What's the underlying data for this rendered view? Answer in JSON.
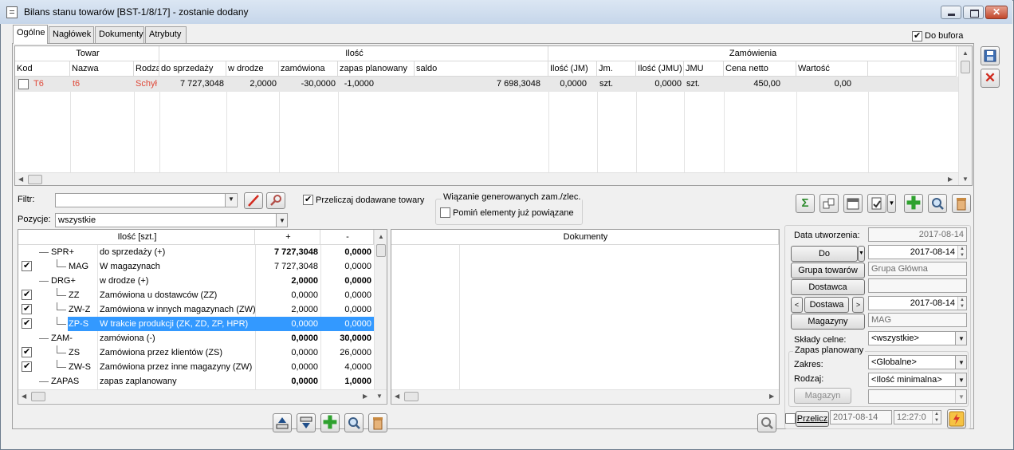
{
  "window": {
    "title": "Bilans stanu towarów [BST-1/8/17] - zostanie dodany"
  },
  "tabs": [
    "Ogólne",
    "Nagłówek",
    "Dokumenty",
    "Atrybuty"
  ],
  "do_bufora": {
    "label": "Do bufora",
    "checked": true
  },
  "top_grid": {
    "groups": {
      "towar": "Towar",
      "ilosc": "Ilość",
      "zamowienia": "Zamówienia"
    },
    "columns": [
      "Kod",
      "Nazwa",
      "Rodza",
      "do sprzedaży",
      "w drodze",
      "zamówiona",
      "zapas planowany",
      "saldo",
      "Ilość (JM)",
      "Jm.",
      "Ilość (JMU)",
      "JMU",
      "Cena netto",
      "Wartość"
    ],
    "row": {
      "kod": "T6",
      "nazwa": "t6",
      "rodzaj": "Schył",
      "do_sprzedazy": "7 727,3048",
      "w_drodze": "2,0000",
      "zamowiona": "-30,0000",
      "zapas": "-1,0000",
      "saldo": "7 698,3048",
      "ilosc_jm": "0,0000",
      "jm": "szt.",
      "ilosc_jmu": "0,0000",
      "jmu": "szt.",
      "cena": "450,00",
      "wartosc": "0,00"
    }
  },
  "filter": {
    "label": "Filtr:",
    "value": ""
  },
  "pozycje": {
    "label": "Pozycje:",
    "value": "wszystkie"
  },
  "przeliczaj": {
    "label": "Przeliczaj dodawane towary",
    "checked": true
  },
  "wiazanie": {
    "title": "Wiązanie generowanych zam./zlec.",
    "pomin_label": "Pomiń elementy już powiązane",
    "checked": false
  },
  "tree": {
    "headers": {
      "ilosc": "Ilość [szt.]",
      "plus": "+",
      "minus": "-"
    },
    "rows": [
      {
        "checked": null,
        "code": "SPR+",
        "name": "do sprzedaży (+)",
        "plus": "7 727,3048",
        "minus": "0,0000",
        "bold": true,
        "indent": 0
      },
      {
        "checked": true,
        "code": "MAG",
        "name": "W magazynach",
        "plus": "7 727,3048",
        "minus": "0,0000",
        "bold": false,
        "indent": 1
      },
      {
        "checked": null,
        "code": "DRG+",
        "name": "w drodze (+)",
        "plus": "2,0000",
        "minus": "0,0000",
        "bold": true,
        "indent": 0
      },
      {
        "checked": true,
        "code": "ZZ",
        "name": "Zamówiona u dostawców (ZZ)",
        "plus": "0,0000",
        "minus": "0,0000",
        "bold": false,
        "indent": 1
      },
      {
        "checked": true,
        "code": "ZW-Z",
        "name": "Zamówiona w innych magazynach (ZW)",
        "plus": "2,0000",
        "minus": "0,0000",
        "bold": false,
        "indent": 1
      },
      {
        "checked": true,
        "code": "ZP-S",
        "name": "W trakcie produkcji (ZK, ZD, ZP, HPR)",
        "plus": "0,0000",
        "minus": "0,0000",
        "bold": false,
        "indent": 1,
        "selected": true
      },
      {
        "checked": null,
        "code": "ZAM-",
        "name": "zamówiona (-)",
        "plus": "0,0000",
        "minus": "30,0000",
        "bold": true,
        "indent": 0
      },
      {
        "checked": true,
        "code": "ZS",
        "name": "Zamówiona przez klientów (ZS)",
        "plus": "0,0000",
        "minus": "26,0000",
        "bold": false,
        "indent": 1
      },
      {
        "checked": true,
        "code": "ZW-S",
        "name": "Zamówiona przez inne magazyny (ZW)",
        "plus": "0,0000",
        "minus": "4,0000",
        "bold": false,
        "indent": 1
      },
      {
        "checked": null,
        "code": "ZAPAS",
        "name": "zapas zaplanowany",
        "plus": "0,0000",
        "minus": "1,0000",
        "bold": true,
        "indent": 0
      }
    ]
  },
  "documents": {
    "header": "Dokumenty"
  },
  "right_panel": {
    "data_utworzenia_label": "Data utworzenia:",
    "data_utworzenia": "2017-08-14",
    "do_label": "Do",
    "do_date": "2017-08-14",
    "grupa_label": "Grupa towarów",
    "grupa_value": "Grupa Główna",
    "dostawca_label": "Dostawca",
    "dostawca_value": "",
    "dostawa_label": "Dostawa",
    "dostawa_date": "2017-08-14",
    "magazyny_label": "Magazyny",
    "magazyny_value": "MAG",
    "sklady_label": "Składy celne:",
    "sklady_value": "<wszystkie>",
    "zapas_title": "Zapas planowany",
    "zakres_label": "Zakres:",
    "zakres_value": "<Globalne>",
    "rodzaj_label": "Rodzaj:",
    "rodzaj_value": "<Ilość minimalna>",
    "magazyn_label": "Magazyn",
    "przelicz_label": "Przelicz",
    "przelicz_date": "2017-08-14",
    "przelicz_time": "12:27:0"
  }
}
